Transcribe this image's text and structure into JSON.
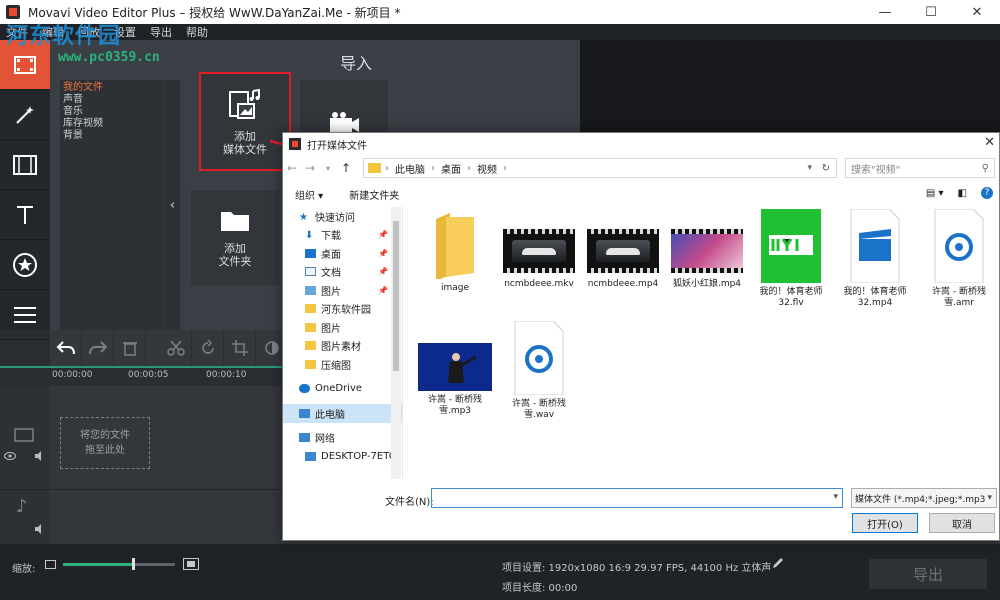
{
  "window": {
    "title": "Movavi Video Editor Plus – 授权给 WwW.DaYanZai.Me - 新项目 *",
    "minimize": "—",
    "maximize": "☐",
    "close": "✕"
  },
  "menu": [
    "文件",
    "编辑",
    "回放",
    "设置",
    "导出",
    "帮助"
  ],
  "watermark": {
    "text": "河东软件园",
    "url": "www.pc0359.cn"
  },
  "import_panel": {
    "heading": "导入",
    "categories": [
      "我的文件",
      "声音",
      "音乐",
      "库存视频",
      "背景"
    ],
    "tiles": {
      "add_media_line1": "添加",
      "add_media_line2": "媒体文件",
      "add_folder_line1": "添加",
      "add_folder_line2": "文件夹"
    }
  },
  "timeline": {
    "ruler": [
      "00:00:00",
      "00:00:05",
      "00:00:10"
    ],
    "drop_zone_line1": "将您的文件",
    "drop_zone_line2": "拖至此处"
  },
  "statusbar": {
    "zoom_label": "缩放:",
    "zoom_level": 0.62,
    "project_settings": "项目设置: 1920x1080 16:9 29.97 FPS, 44100 Hz 立体声",
    "project_length": "项目长度: 00:00",
    "export_button": "导出"
  },
  "dialog": {
    "title": "打开媒体文件",
    "breadcrumb": [
      "此电脑",
      "桌面",
      "视频"
    ],
    "search_placeholder": "搜索\"视频\"",
    "organize": "组织 ▾",
    "new_folder": "新建文件夹",
    "nav": [
      {
        "label": "快速访问",
        "icon": "star-icon",
        "group": true
      },
      {
        "label": "下载",
        "icon": "download-icon",
        "pinned": true
      },
      {
        "label": "桌面",
        "icon": "desktop-icon",
        "pinned": true
      },
      {
        "label": "文档",
        "icon": "document-icon",
        "pinned": true
      },
      {
        "label": "图片",
        "icon": "picture-icon",
        "pinned": true
      },
      {
        "label": "河东软件园",
        "icon": "folder-icon"
      },
      {
        "label": "图片",
        "icon": "folder-icon"
      },
      {
        "label": "图片素材",
        "icon": "folder-icon"
      },
      {
        "label": "压缩图",
        "icon": "folder-icon"
      },
      {
        "label": "OneDrive",
        "icon": "cloud-icon",
        "group": true
      },
      {
        "label": "此电脑",
        "icon": "computer-icon",
        "group": true,
        "selected": true
      },
      {
        "label": "网络",
        "icon": "network-icon",
        "group": true
      },
      {
        "label": "DESKTOP-7ETC",
        "icon": "computer-icon"
      }
    ],
    "files": [
      {
        "name": "image",
        "kind": "folder"
      },
      {
        "name": "ncmbdeee.mkv",
        "kind": "video-car"
      },
      {
        "name": "ncmbdeee.mp4",
        "kind": "video-car"
      },
      {
        "name": "狐妖小红娘.mp4",
        "kind": "video-anime"
      },
      {
        "name": "我的！体育老师32.flv",
        "kind": "iqiyi"
      },
      {
        "name": "我的！体育老师32.mp4",
        "kind": "clapper"
      },
      {
        "name": "许嵩 - 断桥残雪.amr",
        "kind": "audio"
      },
      {
        "name": "许嵩 - 断桥残雪.mp3",
        "kind": "concert"
      },
      {
        "name": "许嵩 - 断桥残雪.wav",
        "kind": "audio"
      }
    ],
    "filename_label": "文件名(N):",
    "filename_value": "",
    "filter": "媒体文件 (*.mp4;*.jpeg;*.mp3",
    "open_button": "打开(O)",
    "cancel_button": "取消"
  }
}
